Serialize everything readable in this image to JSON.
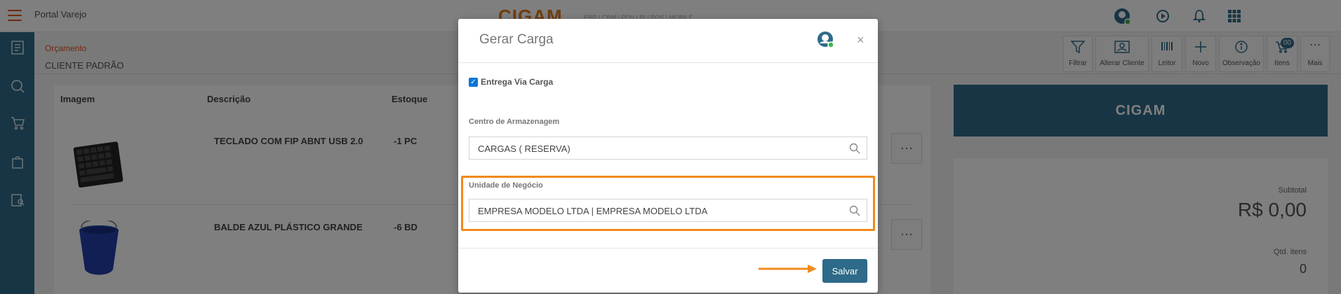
{
  "topbar": {
    "app_title": "Portal Varejo",
    "brand": "CIGAM",
    "brand_tagline": "ERP | CRM | PDV | BI | POS | MOBILE"
  },
  "header": {
    "breadcrumb": "Orçamento",
    "customer": "CLIENTE PADRÃO"
  },
  "toolbar": {
    "items": [
      {
        "label": "Filtrar",
        "icon": "filter-icon"
      },
      {
        "label": "Alterar Cliente",
        "icon": "user-card-icon"
      },
      {
        "label": "Leitor",
        "icon": "barcode-icon"
      },
      {
        "label": "Novo",
        "icon": "plus-icon"
      },
      {
        "label": "Observação",
        "icon": "info-icon"
      },
      {
        "label": "Itens",
        "icon": "cart-icon",
        "badge": "00"
      },
      {
        "label": "Mais",
        "icon": "more-icon"
      }
    ]
  },
  "table": {
    "headers": [
      "Imagem",
      "Descrição",
      "Estoque"
    ],
    "rows": [
      {
        "description": "TECLADO COM FIP ABNT USB 2.0",
        "stock": "-1 PC"
      },
      {
        "description": "BALDE AZUL PLÁSTICO GRANDE",
        "stock": "-6 BD"
      }
    ]
  },
  "summary": {
    "brand": "CIGAM",
    "subtotal_label": "Subtotal",
    "subtotal_value": "R$ 0,00",
    "qty_label": "Qtd. itens",
    "qty_value": "0"
  },
  "modal": {
    "title": "Gerar Carga",
    "close": "×",
    "checkbox_label": "Entrega Via Carga",
    "checkbox_checked": true,
    "warehouse_label": "Centro de Armazenagem",
    "warehouse_value": "CARGAS ( RESERVA)",
    "business_unit_label": "Unidade de Negócio",
    "business_unit_value": "EMPRESA MODELO LTDA | EMPRESA MODELO LTDA",
    "save_label": "Salvar"
  },
  "colors": {
    "primary": "#2e6a89",
    "accent": "#e0531f",
    "highlight": "#f08a1c"
  }
}
